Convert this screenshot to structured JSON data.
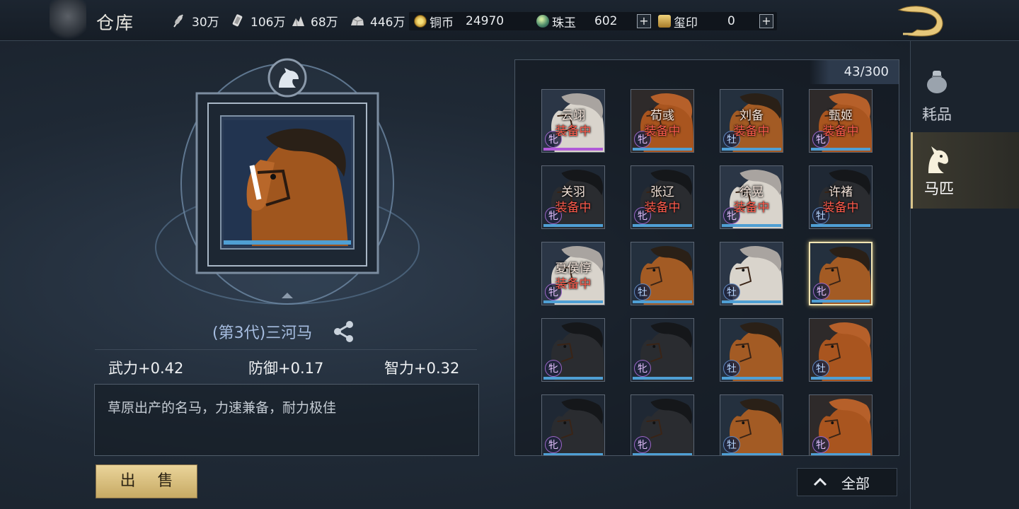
{
  "header": {
    "title": "仓库",
    "resources": [
      {
        "icon": "wheat-icon",
        "value": "30万"
      },
      {
        "icon": "wood-icon",
        "value": "106万"
      },
      {
        "icon": "iron-icon",
        "value": "68万"
      },
      {
        "icon": "stone-icon",
        "value": "446万"
      }
    ],
    "currencies": {
      "copper": {
        "icon": "copper-coin-icon",
        "label": "铜币",
        "value": "24970"
      },
      "jade": {
        "icon": "jade-icon",
        "label": "珠玉",
        "value": "602"
      },
      "seal": {
        "icon": "seal-icon",
        "label": "玺印",
        "value": "0"
      }
    },
    "plus_symbol": "+"
  },
  "side_tabs": [
    {
      "label": "耗品",
      "icon": "pouch-icon",
      "active": false
    },
    {
      "label": "马匹",
      "icon": "horse-head-icon",
      "active": true
    }
  ],
  "detail": {
    "name": "(第3代)三河马",
    "stats": {
      "force": "武力+0.42",
      "defense": "防御+0.17",
      "intellect": "智力+0.32"
    },
    "description": "草原出产的名马，力速兼备，耐力极佳",
    "sell_label": "出 售"
  },
  "inventory": {
    "capacity": "43/300",
    "equipped_label": "装备中",
    "gender_male": "牡",
    "gender_female": "牝",
    "slots": [
      {
        "owner": "云翊",
        "gender": "牝",
        "coat": "white",
        "rarity": "purple"
      },
      {
        "owner": "荀彧",
        "gender": "牝",
        "coat": "chestnut",
        "rarity": "blue"
      },
      {
        "owner": "刘备",
        "gender": "牡",
        "coat": "bay",
        "rarity": "blue"
      },
      {
        "owner": "甄姬",
        "gender": "牝",
        "coat": "chestnut",
        "rarity": "blue"
      },
      {
        "owner": "关羽",
        "gender": "牝",
        "coat": "black",
        "rarity": "blue"
      },
      {
        "owner": "张辽",
        "gender": "牝",
        "coat": "black",
        "rarity": "blue"
      },
      {
        "owner": "徐晃",
        "gender": "牝",
        "coat": "white",
        "rarity": "blue"
      },
      {
        "owner": "许褚",
        "gender": "牡",
        "coat": "black",
        "rarity": "blue"
      },
      {
        "owner": "夏侯惇",
        "gender": "牝",
        "coat": "white",
        "rarity": "blue"
      },
      {
        "owner": "",
        "gender": "牡",
        "coat": "bay",
        "rarity": "blue"
      },
      {
        "owner": "",
        "gender": "牡",
        "coat": "white",
        "rarity": "blue"
      },
      {
        "owner": "",
        "gender": "牝",
        "coat": "bay",
        "rarity": "blue",
        "selected": true
      },
      {
        "owner": "",
        "gender": "牝",
        "coat": "black",
        "rarity": "blue"
      },
      {
        "owner": "",
        "gender": "牝",
        "coat": "black",
        "rarity": "blue"
      },
      {
        "owner": "",
        "gender": "牡",
        "coat": "bay",
        "rarity": "blue"
      },
      {
        "owner": "",
        "gender": "牡",
        "coat": "chestnut",
        "rarity": "blue"
      },
      {
        "owner": "",
        "gender": "牝",
        "coat": "black",
        "rarity": "blue"
      },
      {
        "owner": "",
        "gender": "牝",
        "coat": "black",
        "rarity": "blue"
      },
      {
        "owner": "",
        "gender": "牡",
        "coat": "bay",
        "rarity": "blue"
      },
      {
        "owner": "",
        "gender": "牝",
        "coat": "chestnut",
        "rarity": "blue"
      }
    ],
    "filter_label": "全部"
  },
  "colors": {
    "accent_gold": "#d9c48a",
    "equip_red": "#ff5c4d",
    "name_blue": "#a6bde0"
  }
}
